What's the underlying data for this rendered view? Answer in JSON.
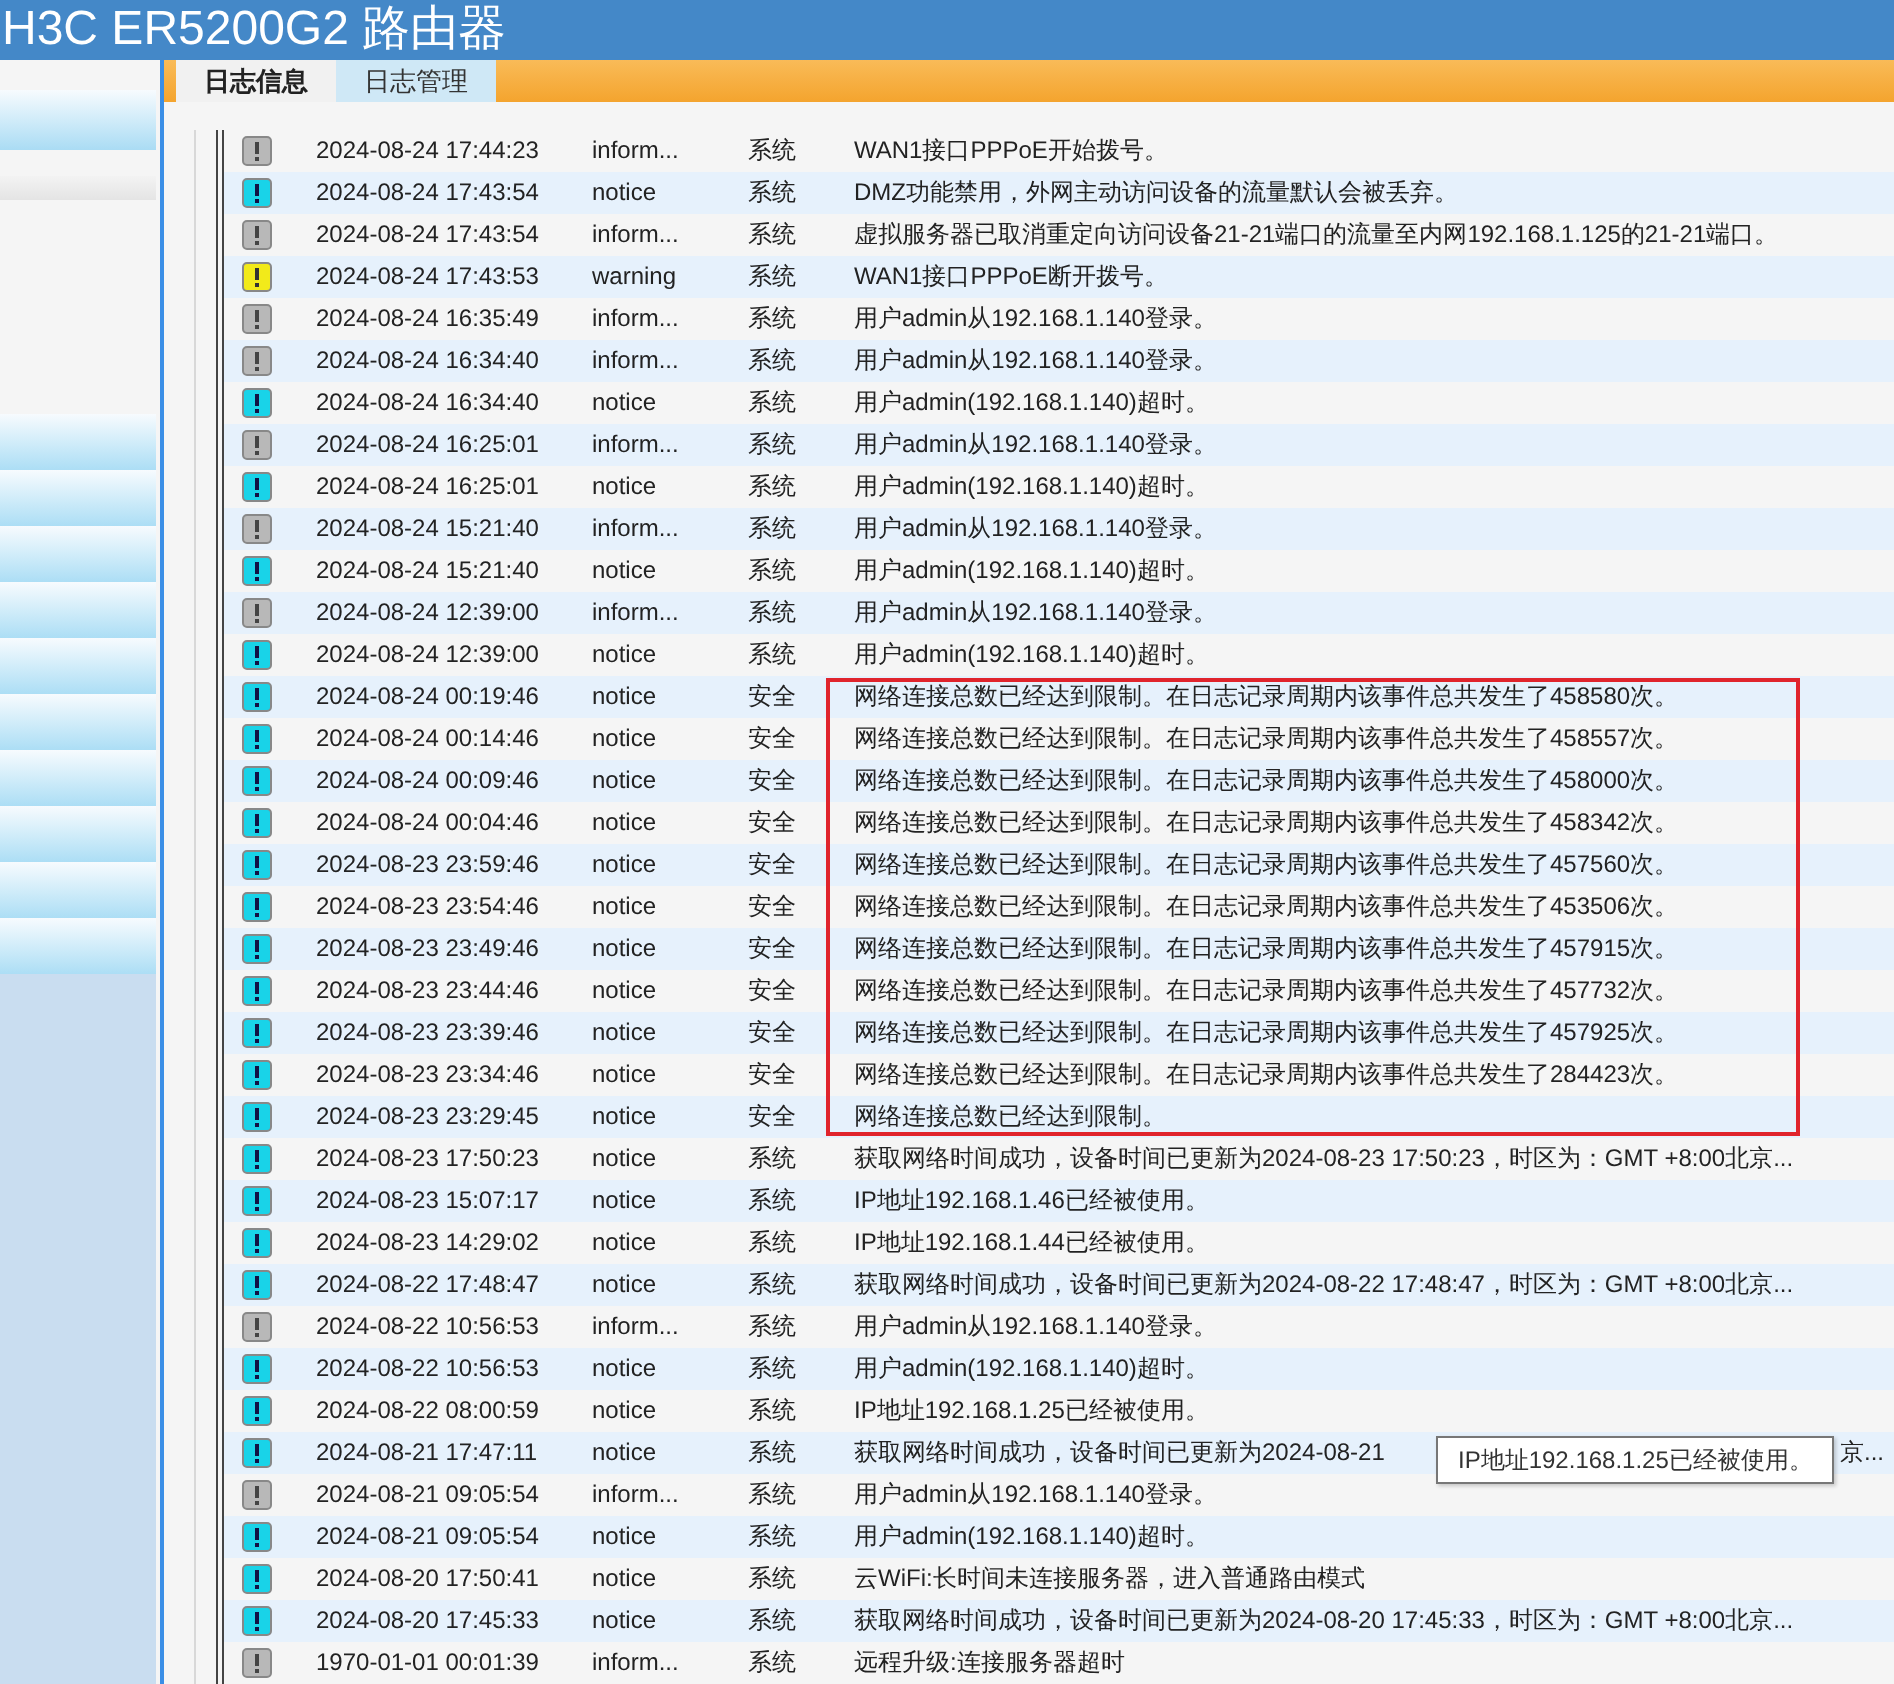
{
  "window": {
    "title": "H3C ER5200G2 路由器"
  },
  "tabs": [
    {
      "label": "日志信息",
      "selected": true
    },
    {
      "label": "日志管理",
      "selected": false
    }
  ],
  "log_groups": [
    {
      "boxed": false,
      "rows": [
        {
          "kind": "inform",
          "time": "2024-08-24 17:44:23",
          "level": "inform...",
          "category": "系统",
          "message": "WAN1接口PPPoE开始拨号。"
        },
        {
          "kind": "notice",
          "time": "2024-08-24 17:43:54",
          "level": "notice",
          "category": "系统",
          "message": "DMZ功能禁用，外网主动访问设备的流量默认会被丢弃。"
        },
        {
          "kind": "inform",
          "time": "2024-08-24 17:43:54",
          "level": "inform...",
          "category": "系统",
          "message": "虚拟服务器已取消重定向访问设备21-21端口的流量至内网192.168.1.125的21-21端口。"
        },
        {
          "kind": "warning",
          "time": "2024-08-24 17:43:53",
          "level": "warning",
          "category": "系统",
          "message": "WAN1接口PPPoE断开拨号。"
        },
        {
          "kind": "inform",
          "time": "2024-08-24 16:35:49",
          "level": "inform...",
          "category": "系统",
          "message": "用户admin从192.168.1.140登录。"
        },
        {
          "kind": "inform",
          "time": "2024-08-24 16:34:40",
          "level": "inform...",
          "category": "系统",
          "message": "用户admin从192.168.1.140登录。"
        },
        {
          "kind": "notice",
          "time": "2024-08-24 16:34:40",
          "level": "notice",
          "category": "系统",
          "message": "用户admin(192.168.1.140)超时。"
        },
        {
          "kind": "inform",
          "time": "2024-08-24 16:25:01",
          "level": "inform...",
          "category": "系统",
          "message": "用户admin从192.168.1.140登录。"
        },
        {
          "kind": "notice",
          "time": "2024-08-24 16:25:01",
          "level": "notice",
          "category": "系统",
          "message": "用户admin(192.168.1.140)超时。"
        },
        {
          "kind": "inform",
          "time": "2024-08-24 15:21:40",
          "level": "inform...",
          "category": "系统",
          "message": "用户admin从192.168.1.140登录。"
        },
        {
          "kind": "notice",
          "time": "2024-08-24 15:21:40",
          "level": "notice",
          "category": "系统",
          "message": "用户admin(192.168.1.140)超时。"
        },
        {
          "kind": "inform",
          "time": "2024-08-24 12:39:00",
          "level": "inform...",
          "category": "系统",
          "message": "用户admin从192.168.1.140登录。"
        },
        {
          "kind": "notice",
          "time": "2024-08-24 12:39:00",
          "level": "notice",
          "category": "系统",
          "message": "用户admin(192.168.1.140)超时。"
        }
      ]
    },
    {
      "boxed": true,
      "rows": [
        {
          "kind": "notice",
          "time": "2024-08-24 00:19:46",
          "level": "notice",
          "category": "安全",
          "message": "网络连接总数已经达到限制。在日志记录周期内该事件总共发生了458580次。"
        },
        {
          "kind": "notice",
          "time": "2024-08-24 00:14:46",
          "level": "notice",
          "category": "安全",
          "message": "网络连接总数已经达到限制。在日志记录周期内该事件总共发生了458557次。"
        },
        {
          "kind": "notice",
          "time": "2024-08-24 00:09:46",
          "level": "notice",
          "category": "安全",
          "message": "网络连接总数已经达到限制。在日志记录周期内该事件总共发生了458000次。"
        },
        {
          "kind": "notice",
          "time": "2024-08-24 00:04:46",
          "level": "notice",
          "category": "安全",
          "message": "网络连接总数已经达到限制。在日志记录周期内该事件总共发生了458342次。"
        },
        {
          "kind": "notice",
          "time": "2024-08-23 23:59:46",
          "level": "notice",
          "category": "安全",
          "message": "网络连接总数已经达到限制。在日志记录周期内该事件总共发生了457560次。"
        },
        {
          "kind": "notice",
          "time": "2024-08-23 23:54:46",
          "level": "notice",
          "category": "安全",
          "message": "网络连接总数已经达到限制。在日志记录周期内该事件总共发生了453506次。"
        },
        {
          "kind": "notice",
          "time": "2024-08-23 23:49:46",
          "level": "notice",
          "category": "安全",
          "message": "网络连接总数已经达到限制。在日志记录周期内该事件总共发生了457915次。"
        },
        {
          "kind": "notice",
          "time": "2024-08-23 23:44:46",
          "level": "notice",
          "category": "安全",
          "message": "网络连接总数已经达到限制。在日志记录周期内该事件总共发生了457732次。"
        },
        {
          "kind": "notice",
          "time": "2024-08-23 23:39:46",
          "level": "notice",
          "category": "安全",
          "message": "网络连接总数已经达到限制。在日志记录周期内该事件总共发生了457925次。"
        },
        {
          "kind": "notice",
          "time": "2024-08-23 23:34:46",
          "level": "notice",
          "category": "安全",
          "message": "网络连接总数已经达到限制。在日志记录周期内该事件总共发生了284423次。"
        },
        {
          "kind": "notice",
          "time": "2024-08-23 23:29:45",
          "level": "notice",
          "category": "安全",
          "message": "网络连接总数已经达到限制。"
        }
      ]
    },
    {
      "boxed": false,
      "rows": [
        {
          "kind": "notice",
          "time": "2024-08-23 17:50:23",
          "level": "notice",
          "category": "系统",
          "message": "获取网络时间成功，设备时间已更新为2024-08-23 17:50:23，时区为：GMT +8:00北京..."
        },
        {
          "kind": "notice",
          "time": "2024-08-23 15:07:17",
          "level": "notice",
          "category": "系统",
          "message": "IP地址192.168.1.46已经被使用。"
        },
        {
          "kind": "notice",
          "time": "2024-08-23 14:29:02",
          "level": "notice",
          "category": "系统",
          "message": "IP地址192.168.1.44已经被使用。"
        },
        {
          "kind": "notice",
          "time": "2024-08-22 17:48:47",
          "level": "notice",
          "category": "系统",
          "message": "获取网络时间成功，设备时间已更新为2024-08-22 17:48:47，时区为：GMT +8:00北京..."
        },
        {
          "kind": "inform",
          "time": "2024-08-22 10:56:53",
          "level": "inform...",
          "category": "系统",
          "message": "用户admin从192.168.1.140登录。"
        },
        {
          "kind": "notice",
          "time": "2024-08-22 10:56:53",
          "level": "notice",
          "category": "系统",
          "message": "用户admin(192.168.1.140)超时。"
        },
        {
          "kind": "notice",
          "time": "2024-08-22 08:00:59",
          "level": "notice",
          "category": "系统",
          "message": "IP地址192.168.1.25已经被使用。"
        },
        {
          "kind": "notice",
          "time": "2024-08-21 17:47:11",
          "level": "notice",
          "category": "系统",
          "message": "获取网络时间成功，设备时间已更新为2024-08-21",
          "message_tail": "京...",
          "tooltip": "IP地址192.168.1.25已经被使用。"
        },
        {
          "kind": "inform",
          "time": "2024-08-21 09:05:54",
          "level": "inform...",
          "category": "系统",
          "message": "用户admin从192.168.1.140登录。"
        },
        {
          "kind": "notice",
          "time": "2024-08-21 09:05:54",
          "level": "notice",
          "category": "系统",
          "message": "用户admin(192.168.1.140)超时。"
        },
        {
          "kind": "notice",
          "time": "2024-08-20 17:50:41",
          "level": "notice",
          "category": "系统",
          "message": "云WiFi:长时间未连接服务器，进入普通路由模式"
        },
        {
          "kind": "notice",
          "time": "2024-08-20 17:45:33",
          "level": "notice",
          "category": "系统",
          "message": "获取网络时间成功，设备时间已更新为2024-08-20 17:45:33，时区为：GMT +8:00北京..."
        },
        {
          "kind": "inform",
          "time": "1970-01-01 00:01:39",
          "level": "inform...",
          "category": "系统",
          "message": "远程升级:连接服务器超时"
        }
      ]
    }
  ]
}
